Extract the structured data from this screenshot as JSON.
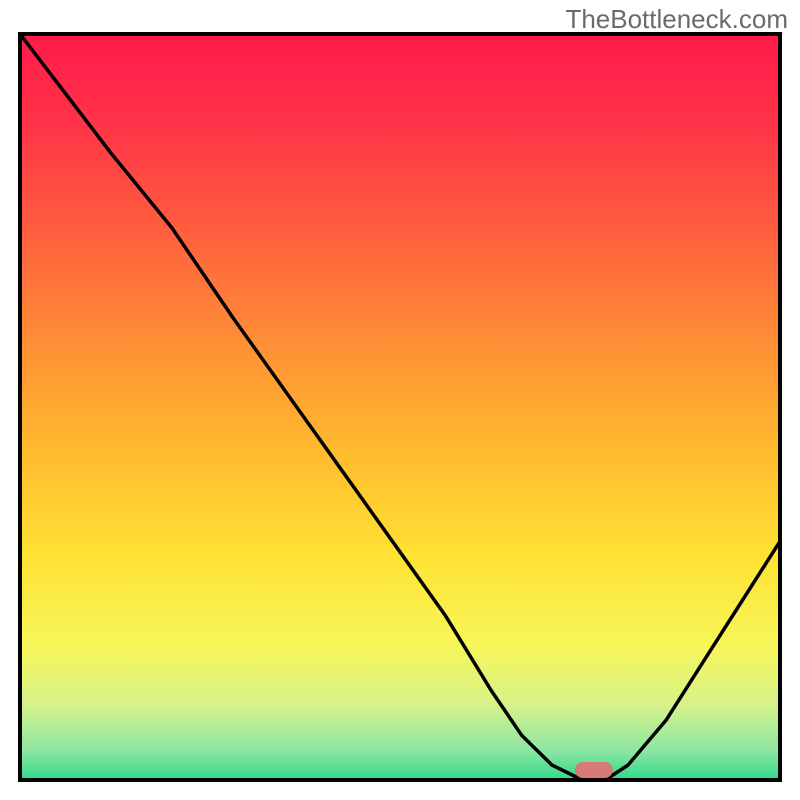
{
  "watermark": "TheBottleneck.com",
  "chart_data": {
    "type": "line",
    "title": "",
    "xlabel": "",
    "ylabel": "",
    "xlim": [
      0,
      100
    ],
    "ylim": [
      0,
      100
    ],
    "series": [
      {
        "name": "bottleneck-curve",
        "x": [
          0,
          6,
          12,
          20,
          28,
          35,
          42,
          49,
          56,
          62,
          66,
          70,
          74,
          77,
          80,
          85,
          90,
          95,
          100
        ],
        "y": [
          100,
          92,
          84,
          74,
          62,
          52,
          42,
          32,
          22,
          12,
          6,
          2,
          0,
          0,
          2,
          8,
          16,
          24,
          32
        ]
      }
    ],
    "marker": {
      "name": "optimal-range-marker",
      "x_center": 75.5,
      "width": 5,
      "color": "#d97a7a"
    },
    "gradient_stops": [
      {
        "offset": 0.0,
        "color": "#ff1a4a"
      },
      {
        "offset": 0.12,
        "color": "#ff3348"
      },
      {
        "offset": 0.25,
        "color": "#ff5a3f"
      },
      {
        "offset": 0.4,
        "color": "#ff8a36"
      },
      {
        "offset": 0.55,
        "color": "#ffb82e"
      },
      {
        "offset": 0.7,
        "color": "#ffe233"
      },
      {
        "offset": 0.82,
        "color": "#f7f75a"
      },
      {
        "offset": 0.9,
        "color": "#d6f28a"
      },
      {
        "offset": 0.96,
        "color": "#8ee6a3"
      },
      {
        "offset": 1.0,
        "color": "#2fd98a"
      }
    ],
    "frame": {
      "stroke": "#000000",
      "stroke_width": 4
    }
  }
}
